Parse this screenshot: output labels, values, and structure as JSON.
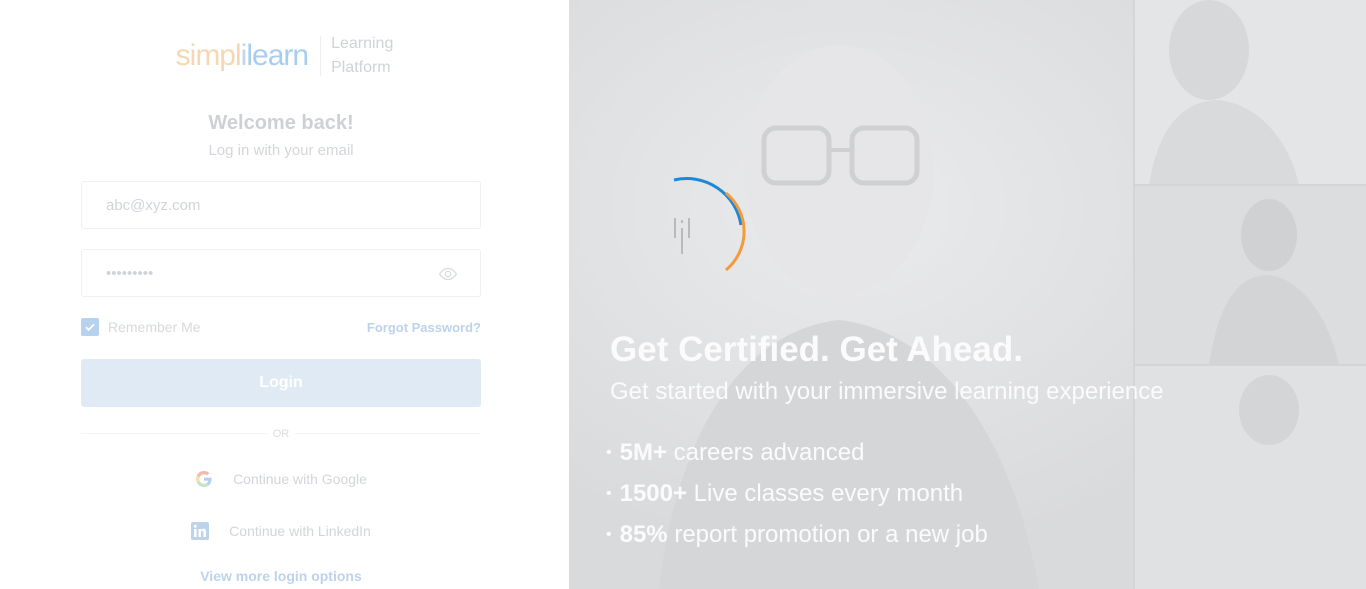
{
  "brand": {
    "logo_text": "simplilearn",
    "logo_parts": [
      "simpl",
      "i",
      "learn"
    ],
    "subtitle_line1": "Learning",
    "subtitle_line2": "Platform",
    "colors": {
      "orange": "#f7c18e",
      "blue": "#a8cdee"
    }
  },
  "login": {
    "welcome": "Welcome back!",
    "subtitle": "Log in with your email",
    "email_placeholder": "abc@xyz.com",
    "password_value": "•••••••••",
    "remember_label": "Remember Me",
    "remember_checked": true,
    "forgot_label": "Forgot Password?",
    "login_label": "Login",
    "or_label": "OR",
    "google_label": "Continue with Google",
    "linkedin_label": "Continue with LinkedIn",
    "more_options_label": "View more login options"
  },
  "hero": {
    "headline": "Get Certified. Get Ahead.",
    "tagline": "Get started with your immersive learning experience",
    "stats": [
      {
        "highlight": "5M+",
        "text": " careers advanced"
      },
      {
        "highlight": "1500+",
        "text": " Live classes every month"
      },
      {
        "highlight": "85%",
        "text": " report promotion or a new job"
      }
    ]
  },
  "icons": {
    "eye": "eye-icon",
    "check": "check-icon",
    "google": "google-icon",
    "linkedin": "linkedin-icon",
    "spinner": "loading-spinner-icon"
  }
}
